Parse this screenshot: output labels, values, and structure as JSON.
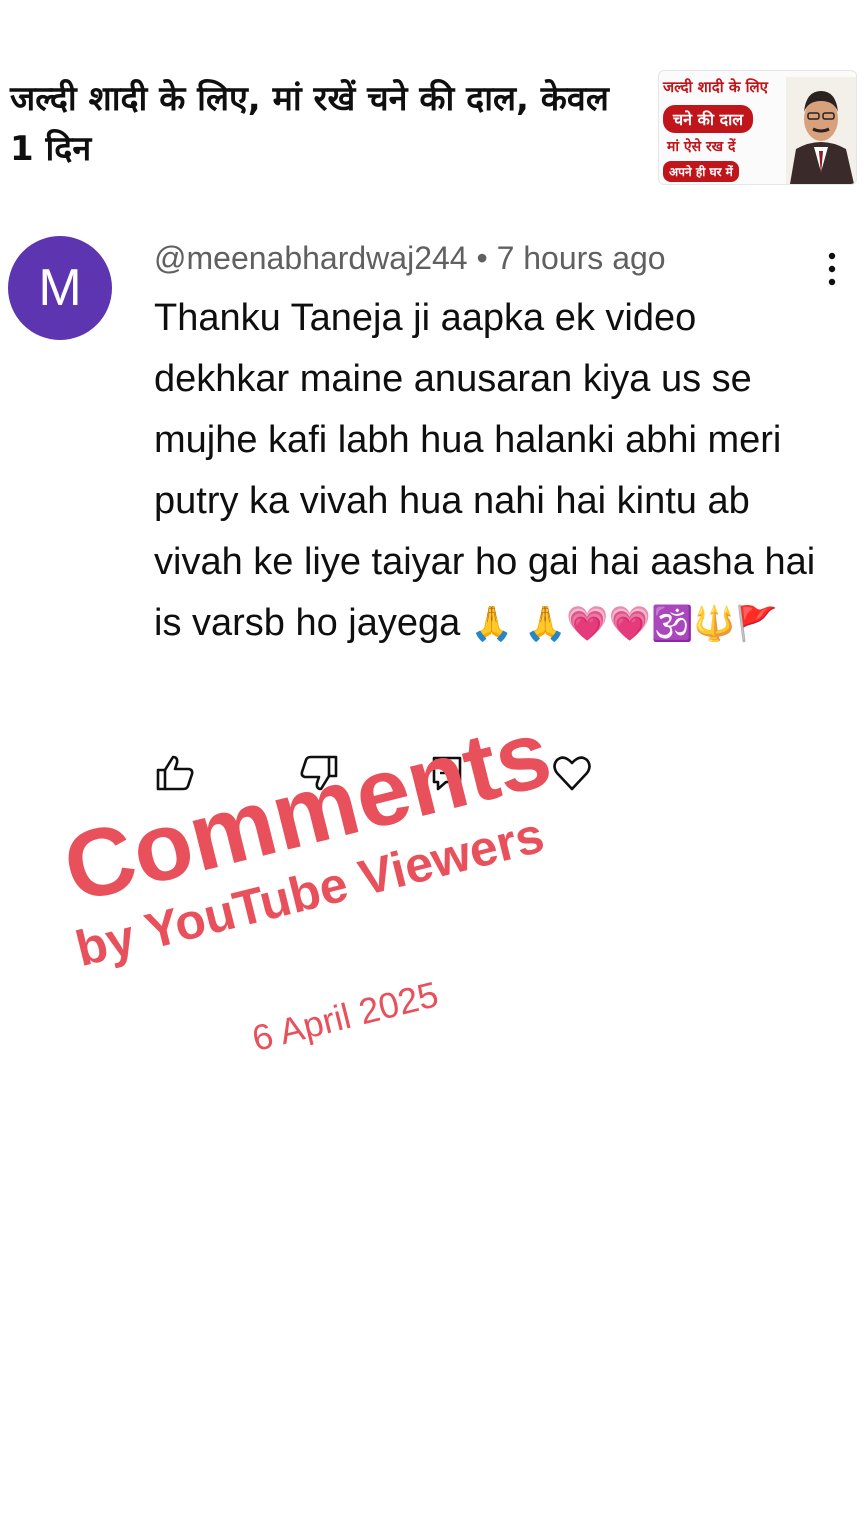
{
  "video": {
    "title": "जल्दी शादी के लिए, मां रखें चने की दाल, केवल 1 दिन",
    "thumbnail": {
      "line1": "जल्दी शादी के लिए",
      "line2": "चने की दाल",
      "line3": "मां ऐसे रख दें",
      "line4": "अपने ही घर में",
      "accent_color": "#c0151b"
    }
  },
  "comment": {
    "avatar_letter": "M",
    "avatar_color": "#5e35b1",
    "author": "@meenabhardwaj244",
    "separator": " • ",
    "time": "7 hours ago",
    "text": "Thanku Taneja ji aapka ek video dekhkar maine anusaran kiya us se mujhe kafi labh hua halanki abhi meri putry ka vivah hua nahi hai kintu ab vivah ke liye taiyar ho gai hai aasha hai is varsb ho jayega ",
    "emojis": "🙏 🙏💗💗🕉️🔱🚩",
    "menu_icon": "more-vert-icon",
    "actions": [
      {
        "icon": "like-icon"
      },
      {
        "icon": "dislike-icon"
      },
      {
        "icon": "reply-icon"
      },
      {
        "icon": "heart-icon"
      }
    ]
  },
  "overlay": {
    "line1": "Comments",
    "line2": "by YouTube Viewers",
    "line3": "6 April 2025",
    "color": "#e8505b"
  }
}
